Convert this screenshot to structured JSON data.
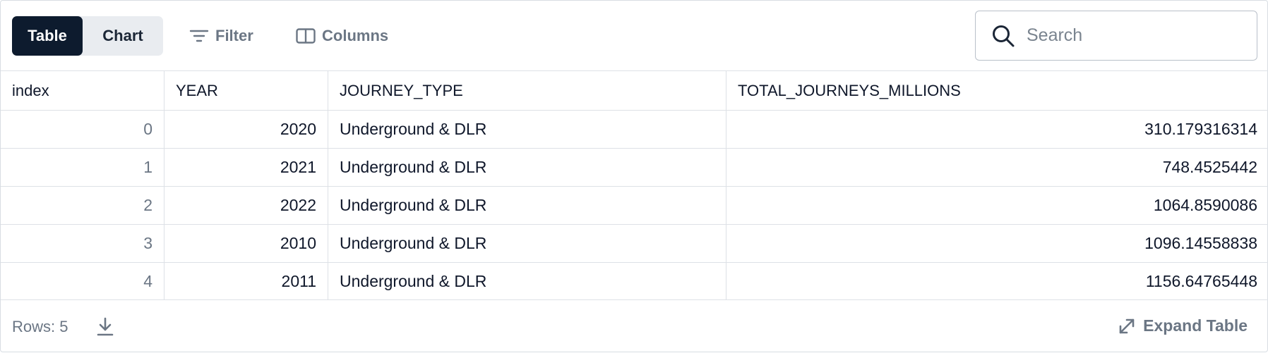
{
  "toolbar": {
    "view_toggle": {
      "table_label": "Table",
      "chart_label": "Chart",
      "selected": "Table"
    },
    "filter_label": "Filter",
    "columns_label": "Columns",
    "search": {
      "placeholder": "Search",
      "value": ""
    }
  },
  "table": {
    "columns": [
      "index",
      "YEAR",
      "JOURNEY_TYPE",
      "TOTAL_JOURNEYS_MILLIONS"
    ],
    "rows": [
      {
        "index": "0",
        "year": "2020",
        "journey_type": "Underground & DLR",
        "total": "310.179316314"
      },
      {
        "index": "1",
        "year": "2021",
        "journey_type": "Underground & DLR",
        "total": "748.4525442"
      },
      {
        "index": "2",
        "year": "2022",
        "journey_type": "Underground & DLR",
        "total": "1064.8590086"
      },
      {
        "index": "3",
        "year": "2010",
        "journey_type": "Underground & DLR",
        "total": "1096.14558838"
      },
      {
        "index": "4",
        "year": "2011",
        "journey_type": "Underground & DLR",
        "total": "1156.64765448"
      }
    ]
  },
  "footer": {
    "rows_label": "Rows: 5",
    "expand_label": "Expand Table"
  },
  "icons": {
    "filter": "filter-icon",
    "columns": "columns-icon",
    "search": "search-icon",
    "download": "download-icon",
    "expand": "expand-icon"
  },
  "colors": {
    "active_toggle": "#0d1b2e",
    "toggle_bg": "#e9ecf0",
    "muted_text": "#6b7684"
  }
}
